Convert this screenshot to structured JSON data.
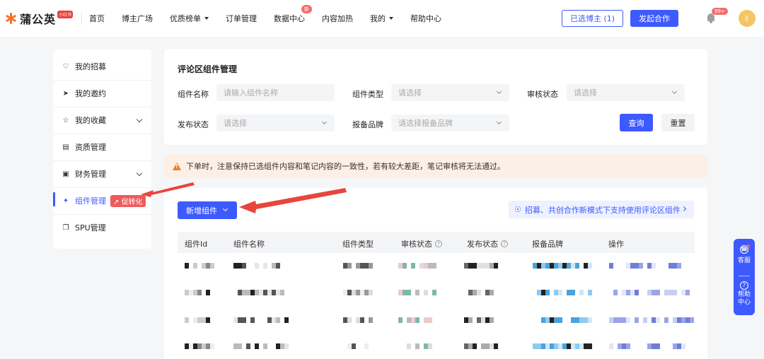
{
  "brand": {
    "name": "蒲公英",
    "badge": "小红书"
  },
  "nav": [
    {
      "label": "首页",
      "dropdown": false
    },
    {
      "label": "博主广场",
      "dropdown": false
    },
    {
      "label": "优质榜单",
      "dropdown": true
    },
    {
      "label": "订单管理",
      "dropdown": false
    },
    {
      "label": "数据中心",
      "dropdown": false,
      "badge": "新"
    },
    {
      "label": "内容加热",
      "dropdown": false
    },
    {
      "label": "我的",
      "dropdown": true
    },
    {
      "label": "帮助中心",
      "dropdown": false
    }
  ],
  "header": {
    "selected_bloggers": "已选博主 (1)",
    "start_cooperation": "发起合作",
    "notification_count": "99+"
  },
  "sidebar": {
    "items": [
      {
        "label": "我的招募",
        "icon": "recruit-icon"
      },
      {
        "label": "我的邀约",
        "icon": "send-icon"
      },
      {
        "label": "我的收藏",
        "icon": "star-icon",
        "expandable": true
      },
      {
        "label": "资质管理",
        "icon": "document-icon"
      },
      {
        "label": "财务管理",
        "icon": "wallet-icon",
        "expandable": true
      },
      {
        "label": "组件管理",
        "icon": "component-icon",
        "active": true,
        "tag": "促转化"
      },
      {
        "label": "SPU管理",
        "icon": "copy-icon"
      }
    ]
  },
  "filter": {
    "title": "评论区组件管理",
    "component_name": {
      "label": "组件名称",
      "placeholder": "请输入组件名称"
    },
    "component_type": {
      "label": "组件类型",
      "placeholder": "请选择"
    },
    "review_status": {
      "label": "审核状态",
      "placeholder": "请选择"
    },
    "publish_status": {
      "label": "发布状态",
      "placeholder": "请选择"
    },
    "brand": {
      "label": "报备品牌",
      "placeholder": "请选择报备品牌"
    },
    "query_label": "查询",
    "reset_label": "重置"
  },
  "warning": {
    "text": "下单时，注意保持已选组件内容和笔记内容的一致性，若有较大差距，笔记审核将无法通过。"
  },
  "main": {
    "add_label": "新增组件",
    "tip": "招募、共创合作新模式下支持使用评论区组件",
    "columns": [
      {
        "label": "组件Id"
      },
      {
        "label": "组件名称"
      },
      {
        "label": "组件类型"
      },
      {
        "label": "审核状态",
        "help": true
      },
      {
        "label": "发布状态",
        "help": true
      },
      {
        "label": "报备品牌"
      },
      {
        "label": "操作"
      }
    ]
  },
  "float_panel": {
    "service_label": "客服",
    "help_label": "帮助中心"
  },
  "colors": {
    "primary": "#3d5afe",
    "warning_bg": "#fcefe6",
    "warning_icon": "#f07a2a",
    "badge_red": "#f56c6c",
    "arrow_red": "#e8453c"
  }
}
